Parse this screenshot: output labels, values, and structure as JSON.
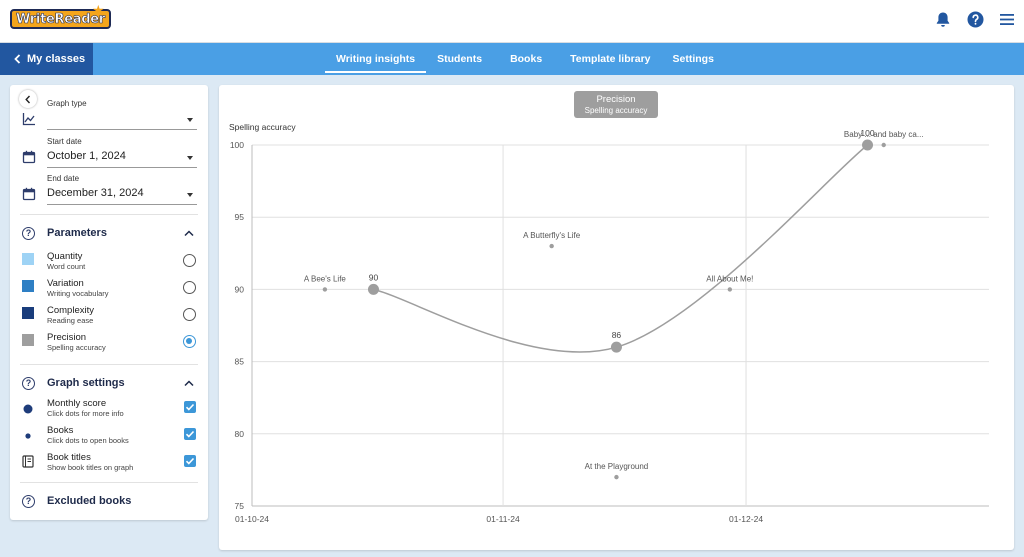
{
  "app": {
    "logo_text": "WriteReader"
  },
  "header": {
    "icons": [
      "bell-icon",
      "help-icon",
      "menu-icon"
    ]
  },
  "nav": {
    "back_label": "My classes",
    "tabs": [
      {
        "label": "Writing insights",
        "active": true
      },
      {
        "label": "Students"
      },
      {
        "label": "Books"
      },
      {
        "label": "Template library"
      },
      {
        "label": "Settings"
      }
    ]
  },
  "panel": {
    "graph_type": {
      "label": "Graph type",
      "value": ""
    },
    "start_date": {
      "label": "Start date",
      "value": "October 1, 2024"
    },
    "end_date": {
      "label": "End date",
      "value": "December 31, 2024"
    },
    "parameters": {
      "title": "Parameters",
      "items": [
        {
          "title": "Quantity",
          "subtitle": "Word count",
          "color": "#9ed3f5",
          "selected": false
        },
        {
          "title": "Variation",
          "subtitle": "Writing vocabulary",
          "color": "#2e7fc4",
          "selected": false
        },
        {
          "title": "Complexity",
          "subtitle": "Reading ease",
          "color": "#1a3d7c",
          "selected": false
        },
        {
          "title": "Precision",
          "subtitle": "Spelling accuracy",
          "color": "#9e9e9e",
          "selected": true
        }
      ]
    },
    "graph_settings": {
      "title": "Graph settings",
      "items": [
        {
          "title": "Monthly score",
          "subtitle": "Click dots for more info",
          "checked": true
        },
        {
          "title": "Books",
          "subtitle": "Click dots to open books",
          "checked": true
        },
        {
          "title": "Book titles",
          "subtitle": "Show book titles on graph",
          "checked": true
        }
      ]
    },
    "excluded": {
      "title": "Excluded books"
    }
  },
  "chart_data": {
    "type": "line",
    "legend": {
      "title": "Precision",
      "subtitle": "Spelling accuracy"
    },
    "ylabel": "Spelling accuracy",
    "ylim": [
      75,
      100
    ],
    "yticks": [
      75,
      80,
      85,
      90,
      95,
      100
    ],
    "xlim": [
      "2024-10-01",
      "2024-12-31"
    ],
    "xticks": [
      "01-10-24",
      "01-11-24",
      "01-12-24"
    ],
    "grid": true,
    "series_color": "#9e9e9e",
    "monthly_scores": [
      {
        "date": "2024-10-16",
        "value": 90,
        "label": "90"
      },
      {
        "date": "2024-11-15",
        "value": 86,
        "label": "86"
      },
      {
        "date": "2024-12-16",
        "value": 100,
        "label": "100"
      }
    ],
    "books": [
      {
        "title": "A Bee's Life",
        "date": "2024-10-10",
        "value": 90
      },
      {
        "title": "A Butterfly's Life",
        "date": "2024-11-07",
        "value": 93
      },
      {
        "title": "At the Playground",
        "date": "2024-11-15",
        "value": 77
      },
      {
        "title": "All About Me!",
        "date": "2024-11-29",
        "value": 90
      },
      {
        "title": "Baby ... and baby ca...",
        "date": "2024-12-18",
        "value": 100
      }
    ]
  }
}
